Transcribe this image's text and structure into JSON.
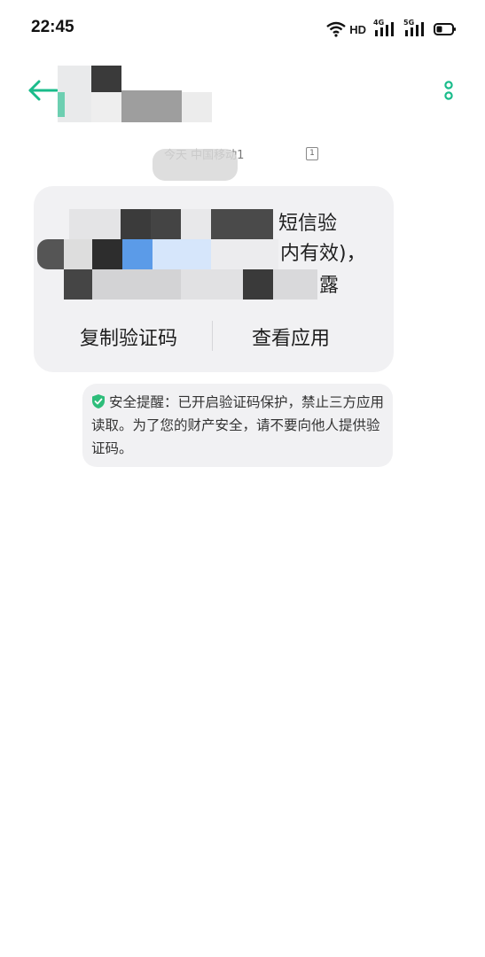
{
  "status_bar": {
    "time": "22:45",
    "network_hd": "HD",
    "sim1_type": "4G",
    "sim2_type": "5G"
  },
  "conversation": {
    "sim_label": "今天 中国移动1",
    "sim_badge": "1",
    "message": {
      "line1_prefix": "【",
      "line1_suffix": "短信验",
      "line2_suffix": "内有效)，",
      "line3_suffix": "露"
    },
    "actions": {
      "copy_code": "复制验证码",
      "view_app": "查看应用"
    },
    "security_tip": {
      "text": "安全提醒：已开启验证码保护，禁止三方应用读取。为了您的财产安全，请不要向他人提供验证码。"
    }
  },
  "colors": {
    "accent": "#1ABC8B",
    "bubble_bg": "#F1F1F3",
    "shield": "#2DBD7A"
  }
}
